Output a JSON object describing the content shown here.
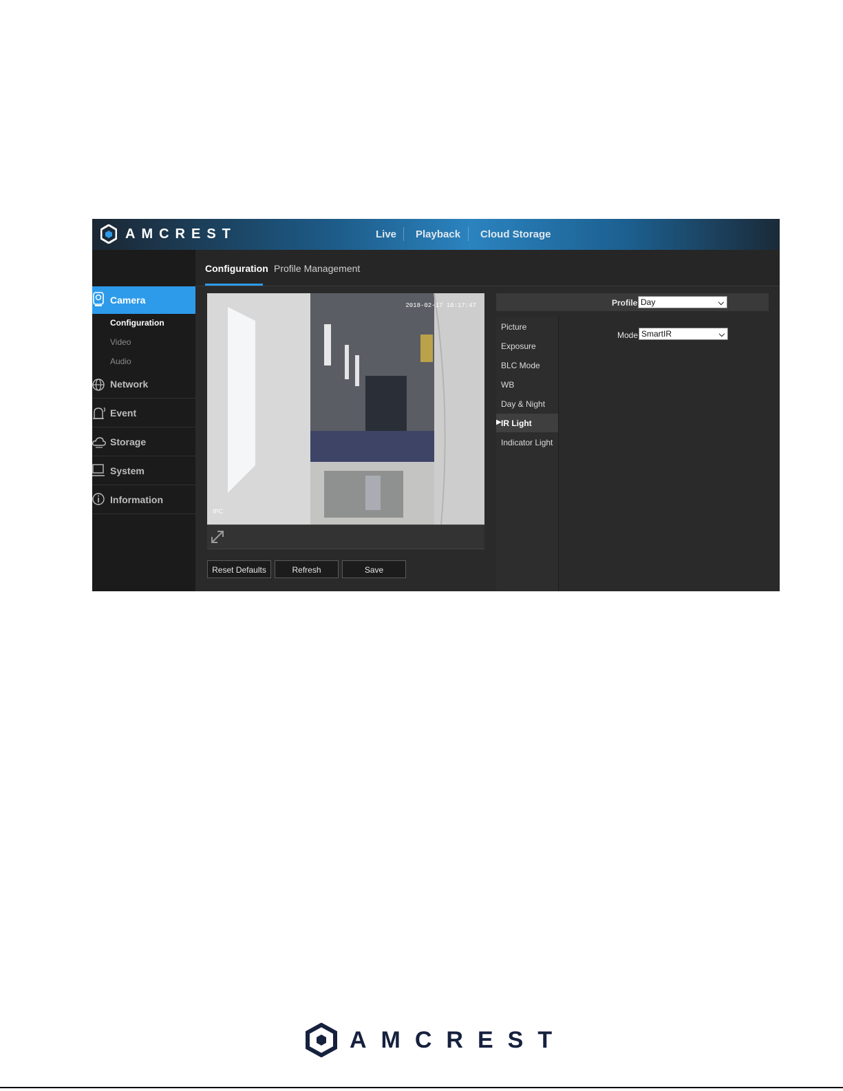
{
  "brand": {
    "name": "AMCREST",
    "logo_icon": "hexagon-logo-icon"
  },
  "top_nav": {
    "live": "Live",
    "playback": "Playback",
    "cloud_storage": "Cloud Storage"
  },
  "tabs": {
    "configuration": "Configuration",
    "profile_management": "Profile Management"
  },
  "sidebar": {
    "camera": "Camera",
    "camera_sub": {
      "configuration": "Configuration",
      "video": "Video",
      "audio": "Audio"
    },
    "network": "Network",
    "event": "Event",
    "storage": "Storage",
    "system": "System",
    "information": "Information"
  },
  "video": {
    "timestamp": "2018-02-17 10:17:47",
    "channel": "IPC"
  },
  "buttons": {
    "reset_defaults": "Reset Defaults",
    "refresh": "Refresh",
    "save": "Save"
  },
  "profile": {
    "label": "Profile",
    "value": "Day"
  },
  "submenu": {
    "picture": "Picture",
    "exposure": "Exposure",
    "blc_mode": "BLC Mode",
    "wb": "WB",
    "day_night": "Day & Night",
    "ir_light": "IR Light",
    "indicator_light": "Indicator Light",
    "active": "IR Light"
  },
  "mode": {
    "label": "Mode",
    "value": "SmartIR"
  },
  "colors": {
    "accent": "#2d9bea",
    "footer_logo": "#16213e"
  }
}
